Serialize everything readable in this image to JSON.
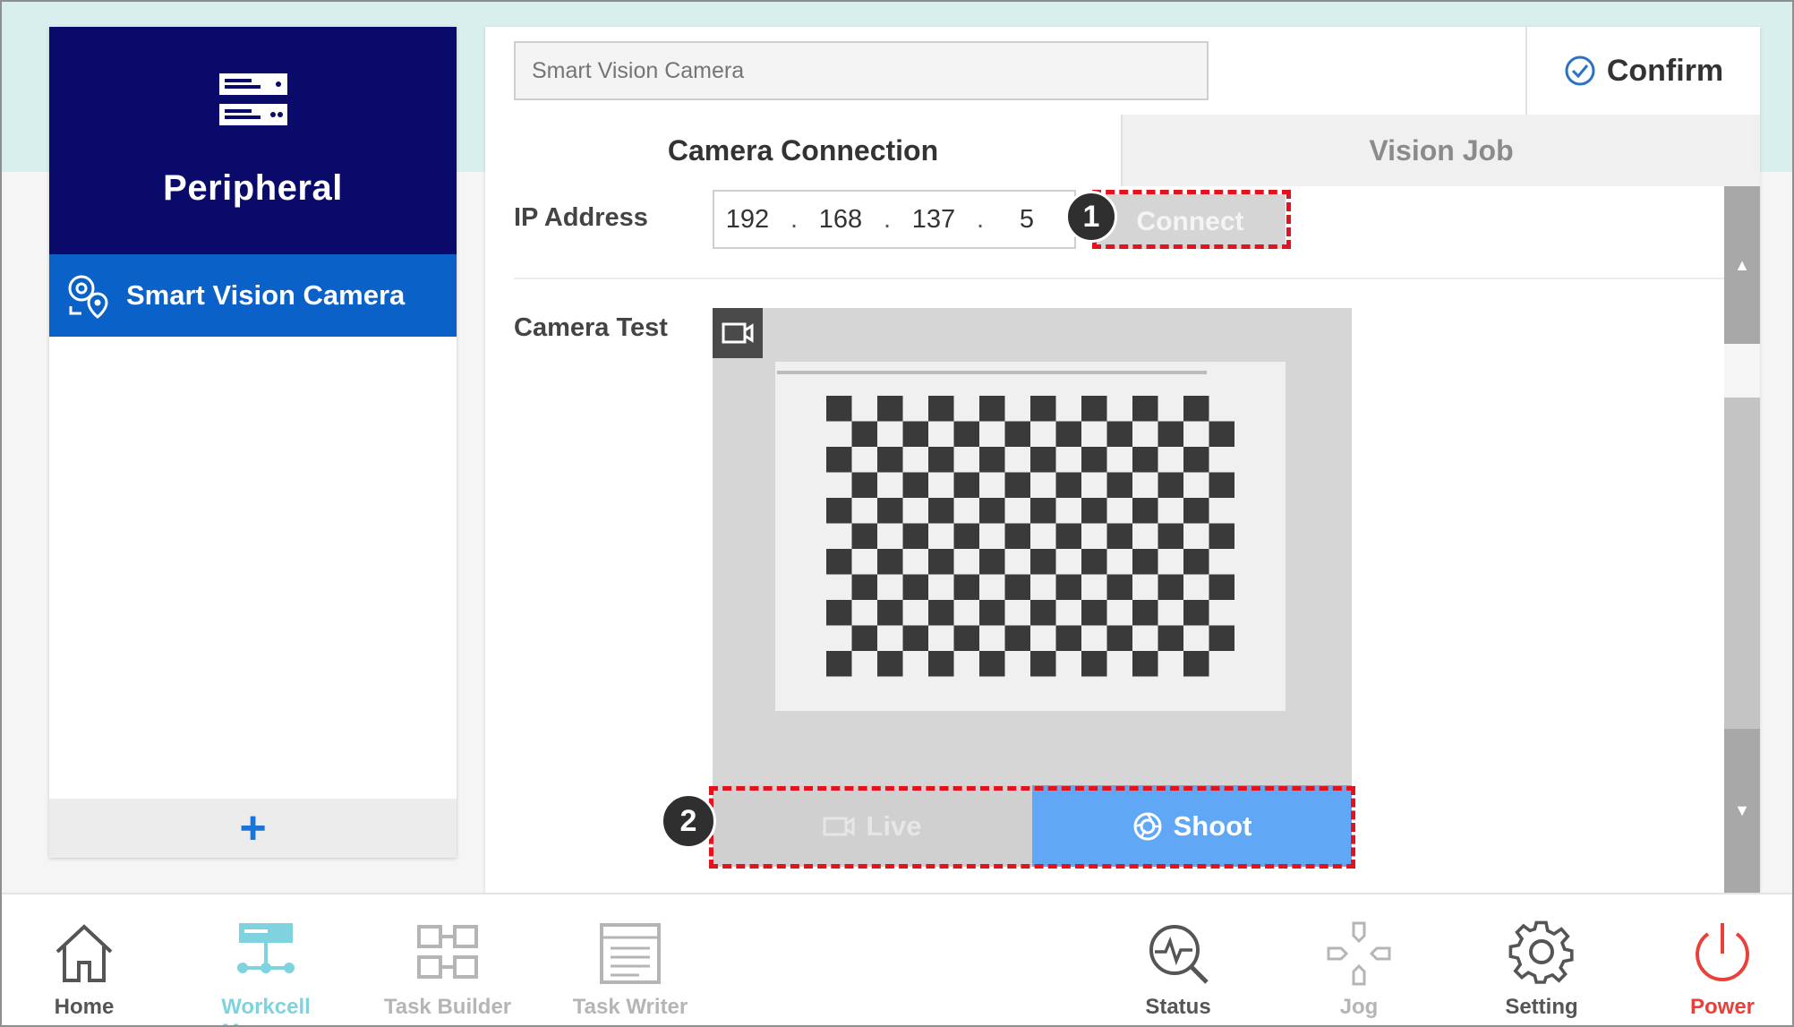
{
  "left_panel": {
    "title": "Peripheral",
    "title_icon": "server-icon",
    "items": [
      {
        "label": "Smart Vision Camera",
        "icon": "vision-camera-location-icon",
        "selected": true
      }
    ],
    "add_label": "+"
  },
  "main": {
    "name_field": {
      "placeholder": "Smart Vision Camera"
    },
    "confirm_label": "Confirm",
    "tabs": [
      {
        "label": "Camera Connection",
        "active": true
      },
      {
        "label": "Vision Job",
        "active": false
      }
    ],
    "ip_label": "IP Address",
    "ip_octets": [
      "192",
      "168",
      "137",
      "5"
    ],
    "ip_separator": ".",
    "connect_label": "Connect",
    "camera_test_label": "Camera Test",
    "live_label": "Live",
    "shoot_label": "Shoot"
  },
  "annotations": {
    "badge_1": "1",
    "badge_2": "2",
    "highlight_color": "#e3121d"
  },
  "bottom_nav": [
    {
      "label": "Home",
      "icon": "home-icon",
      "color": "#555555"
    },
    {
      "label": "Workcell Manager",
      "icon": "workcell-icon",
      "color": "#7fd3df"
    },
    {
      "label": "Task Builder",
      "icon": "task-builder-icon",
      "color": "#b5b5b5"
    },
    {
      "label": "Task Writer",
      "icon": "task-writer-icon",
      "color": "#b5b5b5"
    },
    {
      "label": "Status",
      "icon": "status-icon",
      "color": "#555555"
    },
    {
      "label": "Jog",
      "icon": "jog-icon",
      "color": "#b5b5b5"
    },
    {
      "label": "Setting",
      "icon": "gear-icon",
      "color": "#555555"
    },
    {
      "label": "Power",
      "icon": "power-icon",
      "color": "#e9403a"
    }
  ],
  "colors": {
    "header_navy": "#0a0a6b",
    "selected_blue": "#0a62c9",
    "shoot_blue": "#60a8f5",
    "top_band": "#d9efee"
  }
}
